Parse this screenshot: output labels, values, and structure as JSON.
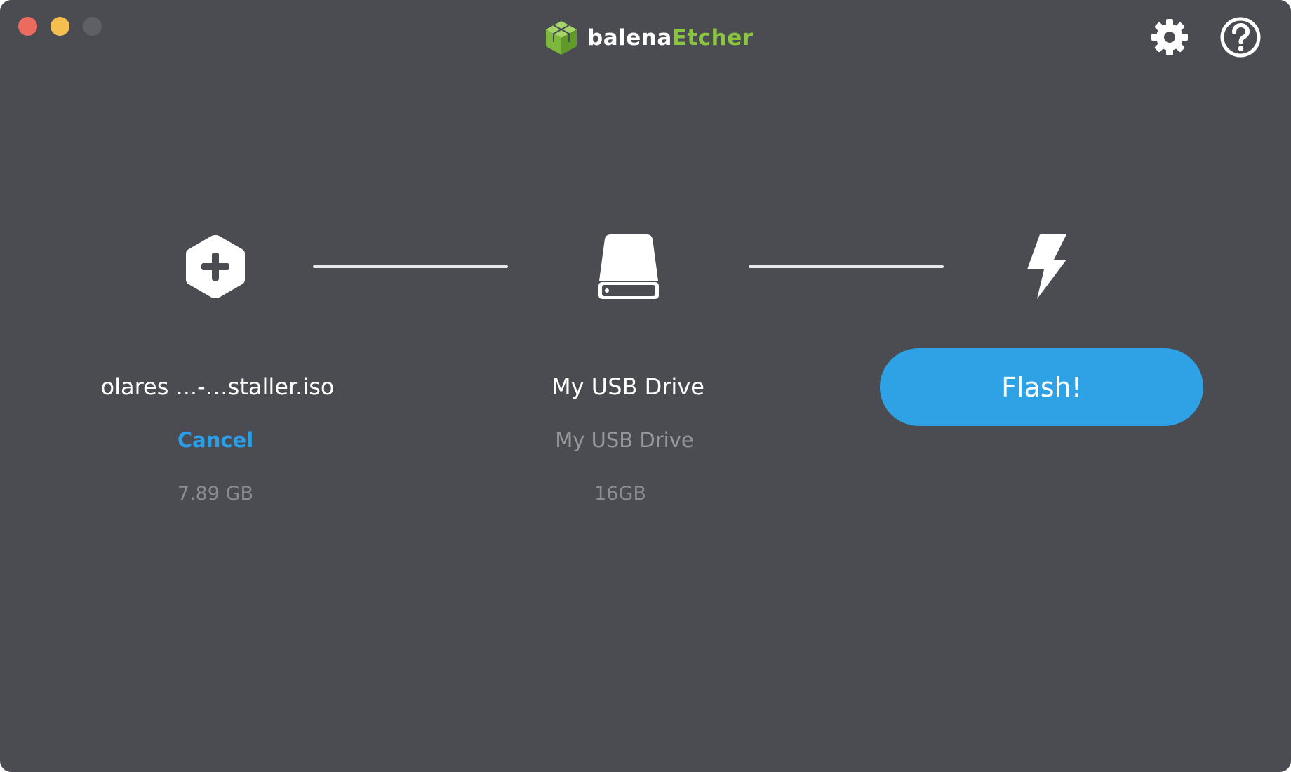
{
  "window": {
    "controls": [
      "close",
      "minimize",
      "maximize"
    ]
  },
  "header": {
    "logo_icon": "balena-cube-icon",
    "logo_text_primary": "balena",
    "logo_text_secondary": "Etcher",
    "settings_icon": "gear-icon",
    "help_icon": "question-mark-icon"
  },
  "steps": {
    "source": {
      "icon": "hexagon-plus-icon",
      "filename": "olares ...-…staller.iso",
      "action_label": "Cancel",
      "size": "7.89 GB"
    },
    "target": {
      "icon": "drive-icon",
      "title": "My USB Drive",
      "subtitle": "My USB Drive",
      "size": "16GB"
    },
    "flash": {
      "icon": "lightning-bolt-icon",
      "button_label": "Flash!"
    }
  },
  "colors": {
    "background": "#4b4c51",
    "accent": "#2fa2e6",
    "brand_green": "#8ac541",
    "close": "#ed6a5e",
    "minimize": "#f4bf4f",
    "maximize_disabled": "#5f6065"
  }
}
